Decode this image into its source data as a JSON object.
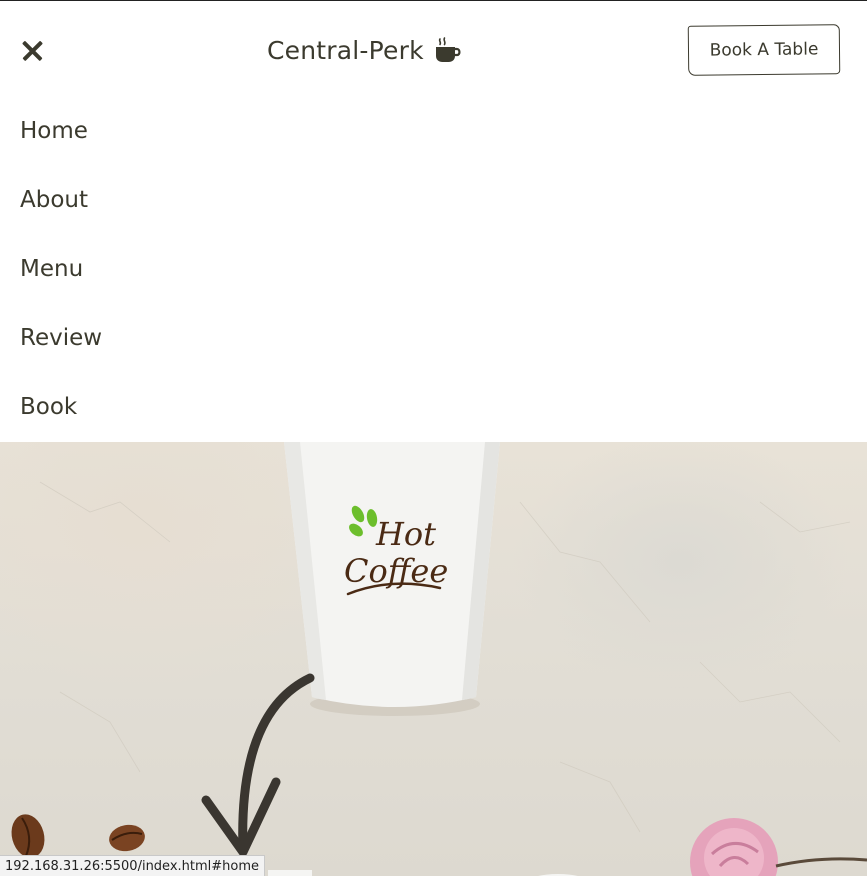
{
  "header": {
    "brand": "Central-Perk",
    "book_button": "Book A Table"
  },
  "menu": {
    "items": [
      {
        "label": "Home"
      },
      {
        "label": "About"
      },
      {
        "label": "Menu"
      },
      {
        "label": "Review"
      },
      {
        "label": "Book"
      }
    ]
  },
  "hero": {
    "cup_logo_line1": "Hot",
    "cup_logo_line2": "Coffee"
  },
  "status_bar": {
    "url": "192.168.31.26:5500/index.html#home"
  },
  "icons": {
    "close": "close-icon",
    "brand": "coffee-cup-icon"
  },
  "colors": {
    "text": "#3b3a2e",
    "accent_green": "#6cbe2c",
    "logo_brown": "#4a2a14"
  }
}
